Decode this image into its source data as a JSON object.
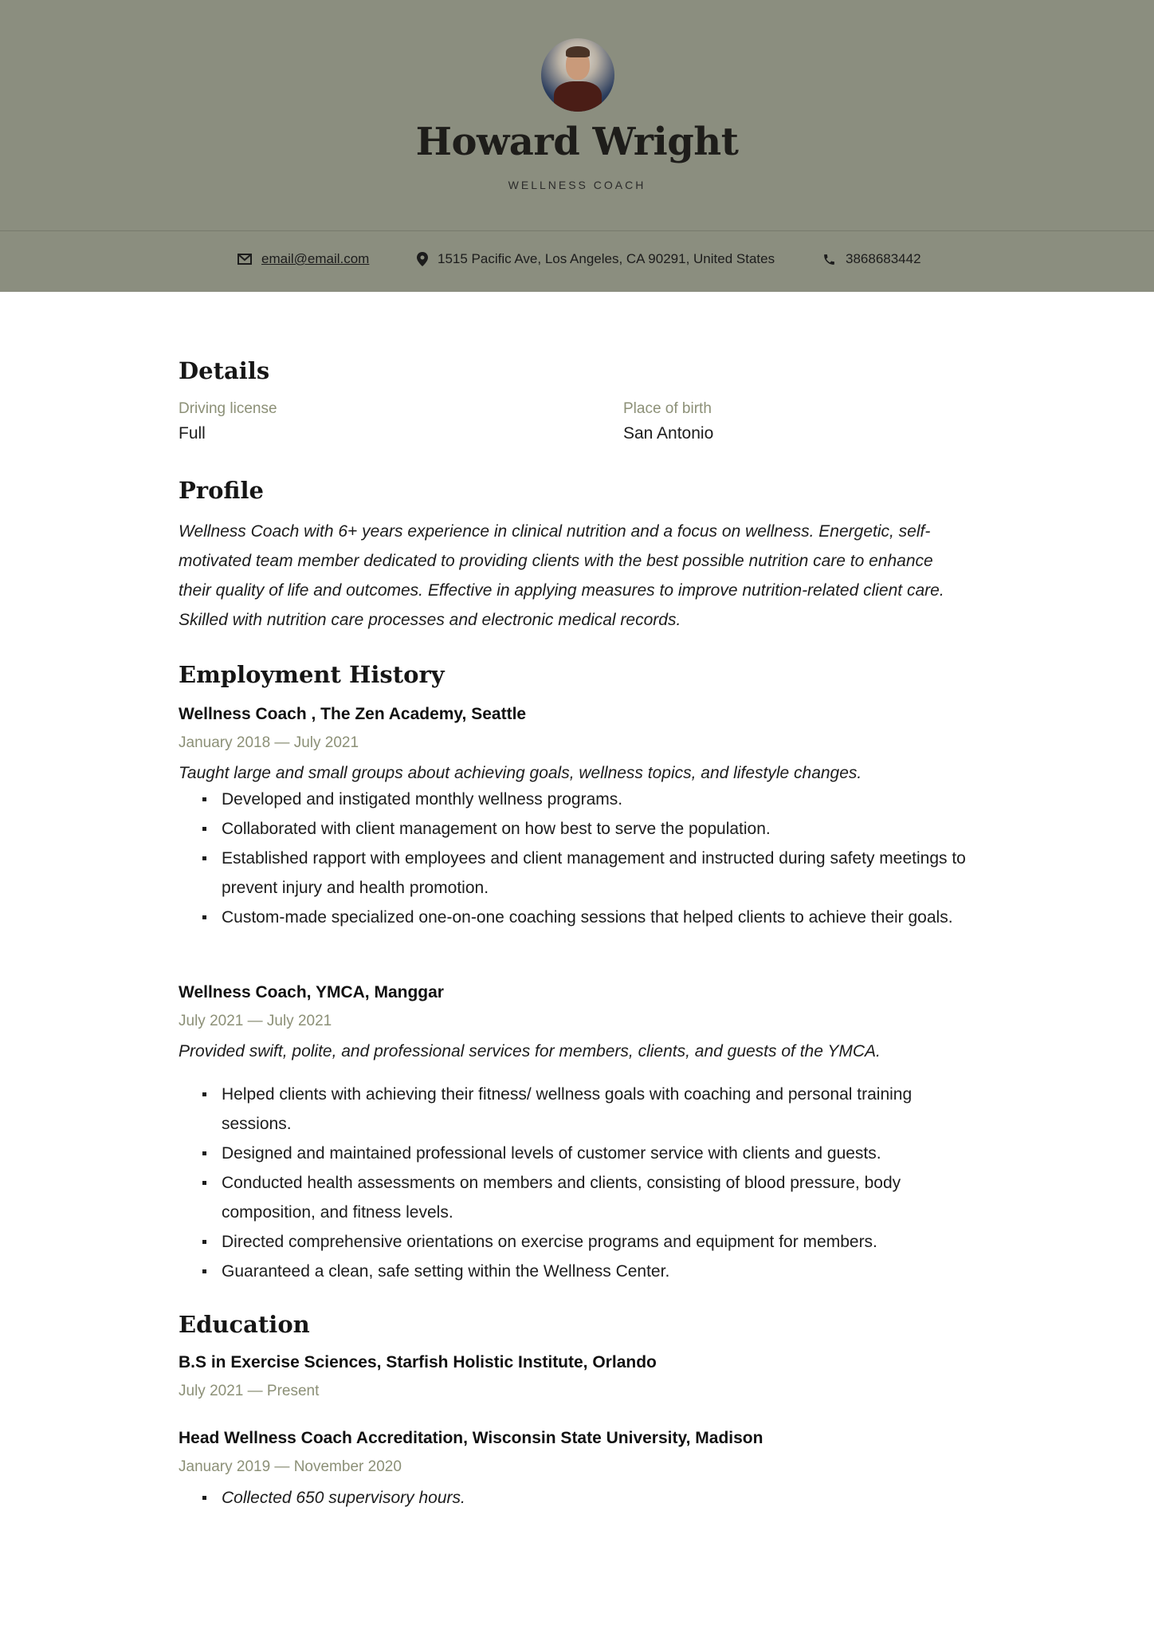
{
  "header": {
    "name": "Howard Wright",
    "title": "WELLNESS COACH",
    "contact": {
      "email": "email@email.com",
      "address": "1515 Pacific Ave, Los Angeles, CA 90291, United States",
      "phone": "3868683442"
    }
  },
  "details": {
    "heading": "Details",
    "driving_license_label": "Driving license",
    "driving_license_value": "Full",
    "place_of_birth_label": "Place of birth",
    "place_of_birth_value": "San Antonio"
  },
  "profile": {
    "heading": "Profile",
    "text": "Wellness Coach with 6+ years experience in clinical nutrition and a focus on wellness. Energetic, self-motivated team member dedicated to providing clients with the best possible nutrition care to enhance their quality of life and outcomes. Effective in applying measures to improve nutrition-related client care. Skilled with nutrition care processes and electronic medical records."
  },
  "employment": {
    "heading": "Employment History",
    "jobs": [
      {
        "title": "Wellness Coach , The Zen Academy, Seattle",
        "dates": "January 2018 — July 2021",
        "description": "Taught large and small groups about achieving goals, wellness topics, and lifestyle changes.",
        "bullets": [
          "Developed and instigated monthly wellness programs.",
          "Collaborated with client management on how best to serve the population.",
          "Established rapport with employees and client management and instructed during safety meetings to prevent injury and health promotion.",
          "Custom-made specialized one-on-one coaching sessions that helped clients to achieve their goals."
        ]
      },
      {
        "title": "Wellness Coach,  YMCA, Manggar",
        "dates": "July 2021 — July 2021",
        "description": "Provided swift, polite, and professional services for members, clients, and guests of the YMCA.",
        "bullets": [
          "Helped clients with achieving their fitness/ wellness goals with coaching and personal training sessions.",
          "Designed and maintained professional levels of customer service with clients and guests.",
          "Conducted health assessments on members and clients, consisting of blood pressure, body composition, and fitness levels.",
          "Directed comprehensive orientations on exercise programs and equipment for members.",
          "Guaranteed a clean, safe setting within the Wellness Center."
        ]
      }
    ]
  },
  "education": {
    "heading": "Education",
    "items": [
      {
        "title": "B.S in Exercise Sciences, Starfish Holistic Institute, Orlando",
        "dates": "July 2021 — Present"
      },
      {
        "title": "Head Wellness Coach Accreditation, Wisconsin State University, Madison",
        "dates": "January 2019 — November 2020",
        "bullets": [
          "Collected 650 supervisory hours."
        ]
      }
    ]
  }
}
